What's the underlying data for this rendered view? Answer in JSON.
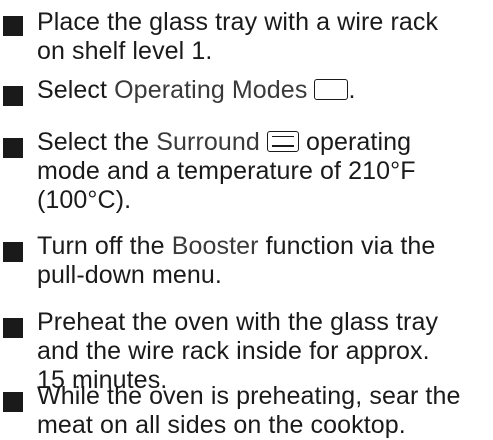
{
  "steps": [
    {
      "text": "Place the glass tray with a wire rack on shelf level 1."
    },
    {
      "prefix": "Select ",
      "ui_label": "Operating Modes",
      "icon": "operating-modes-box-icon",
      "suffix": "."
    },
    {
      "prefix": "Select the ",
      "ui_label": "Surround",
      "icon": "surround-mode-icon",
      "suffix_line1": " operating",
      "line2": "mode and a temperature of 210°F",
      "line3": "(100°C)."
    },
    {
      "prefix": "Turn off the ",
      "ui_label": "Booster",
      "suffix_line1": " function via the",
      "line2": "pull-down menu."
    },
    {
      "line1": "Preheat the oven with the glass tray",
      "line2": "and the wire rack inside for approx.",
      "line3": "15 minutes."
    },
    {
      "line1": "While the oven is preheating, sear the",
      "line2": "meat on all sides on the cooktop."
    }
  ],
  "step1_lines": [
    "Place the glass tray with a wire rack",
    "on shelf level 1."
  ]
}
